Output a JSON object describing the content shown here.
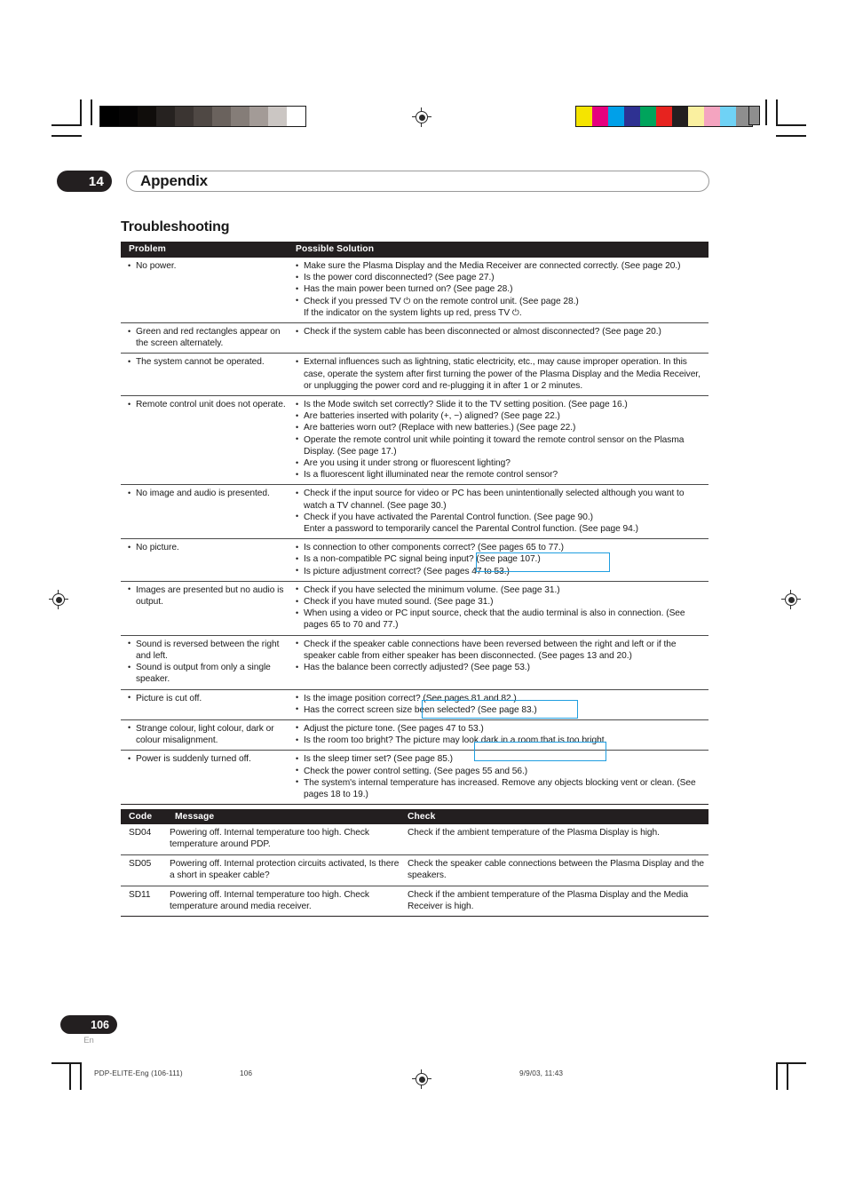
{
  "chapter": {
    "number": "14",
    "title": "Appendix"
  },
  "section": {
    "title": "Troubleshooting"
  },
  "tables": {
    "troubleshooting": {
      "headers": {
        "problem": "Problem",
        "solution": "Possible Solution"
      },
      "rows": [
        {
          "problem": [
            "No power."
          ],
          "solution": [
            "Make sure the Plasma Display and the Media Receiver are connected correctly. (See page 20.)",
            "Is the power cord disconnected? (See page 27.)",
            "Has the main power been turned on? (See page 28.)",
            "Check if you pressed TV ⏻ on the remote control unit. (See page 28.)|If the indicator on the system lights up red, press TV ⏻."
          ]
        },
        {
          "problem": [
            "Green and red rectangles appear on the screen alternately."
          ],
          "solution": [
            "Check if the system cable has been disconnected or almost disconnected? (See page 20.)"
          ]
        },
        {
          "problem": [
            "The system cannot be operated."
          ],
          "solution": [
            "External influences such as lightning, static electricity, etc., may cause improper operation. In this case, operate the system after first turning the power of the Plasma Display and the Media Receiver, or unplugging the power cord and re-plugging it in after 1 or 2 minutes."
          ]
        },
        {
          "problem": [
            "Remote control unit does not operate."
          ],
          "solution": [
            "Is the Mode switch set correctly? Slide it to the TV setting position. (See page 16.)",
            "Are batteries inserted with polarity (+, −) aligned? (See page 22.)",
            "Are batteries worn out? (Replace with new batteries.) (See page 22.)",
            "Operate the remote control unit while pointing it toward the remote control sensor on the Plasma Display. (See page 17.)",
            "Are you using it under strong or fluorescent lighting?",
            "Is a fluorescent light illuminated near the remote control sensor?"
          ]
        },
        {
          "problem": [
            "No image and audio is presented."
          ],
          "solution": [
            "Check if the input source for video or PC has been unintentionally selected although you want to watch a TV channel. (See page 30.)",
            "Check if you have activated the Parental Control function. (See page 90.)|Enter a password to temporarily cancel the Parental Control function. (See page 94.)"
          ]
        },
        {
          "problem": [
            "No picture."
          ],
          "solution": [
            "Is connection to other components correct? (See pages 65 to 77.)",
            "Is a non-compatible PC signal being input? (See page 107.)",
            "Is picture adjustment correct? (See pages 47 to 53.)"
          ]
        },
        {
          "problem": [
            "Images are presented but no audio is output."
          ],
          "solution": [
            "Check if you have selected the minimum volume. (See page 31.)",
            "Check if you have muted sound. (See page 31.)",
            "When using a video or PC input source, check that the audio terminal is also in connection. (See pages 65 to 70 and 77.)"
          ]
        },
        {
          "problem": [
            "Sound is reversed between the right and left.",
            "Sound is output from only a single speaker."
          ],
          "solution": [
            "Check if the speaker cable connections have been reversed between the right and left or if the speaker cable from either speaker has been disconnected. (See pages 13 and 20.)",
            "Has the balance been correctly adjusted? (See page 53.)"
          ]
        },
        {
          "problem": [
            "Picture is cut off."
          ],
          "solution": [
            "Is the image position correct? (See pages 81 and 82.)",
            "Has the correct screen size been selected? (See page 83.)"
          ]
        },
        {
          "problem": [
            "Strange colour, light colour, dark or colour misalignment."
          ],
          "solution": [
            "Adjust the picture tone. (See pages 47 to 53.)",
            "Is the room too bright? The picture may look dark in a room that is too bright."
          ]
        },
        {
          "problem": [
            "Power is suddenly turned off."
          ],
          "solution": [
            "Is the sleep timer set? (See page 85.)",
            "Check the power control setting. (See pages 55 and 56.)",
            "The system's internal temperature has increased. Remove any objects blocking vent or clean. (See pages 18 to 19.)"
          ]
        }
      ]
    },
    "codes": {
      "headers": {
        "code": "Code",
        "message": "Message",
        "check": "Check"
      },
      "rows": [
        {
          "code": "SD04",
          "message": "Powering off. Internal temperature too high. Check temperature around PDP.",
          "check": "Check if the ambient temperature of the Plasma Display is high."
        },
        {
          "code": "SD05",
          "message": "Powering off. Internal protection circuits activated, Is there a short in speaker cable?",
          "check": "Check the speaker cable connections between the Plasma Display and the speakers."
        },
        {
          "code": "SD11",
          "message": "Powering off. Internal temperature too high. Check temperature around media receiver.",
          "check": "Check if the ambient temperature of the Plasma Display and the Media Receiver is high."
        }
      ]
    }
  },
  "page": {
    "number": "106",
    "language": "En"
  },
  "print_footer": {
    "job": "PDP-ELITE-Eng (106-111)",
    "folio": "106",
    "timestamp": "9/9/03, 11:43"
  },
  "print_marks": {
    "grayscale_swatches": [
      "#000000",
      "#050404",
      "#100d0b",
      "#262220",
      "#3b3532",
      "#4f4844",
      "#6a625d",
      "#857d78",
      "#a39b97",
      "#cbc6c3",
      "#ffffff"
    ],
    "color_swatches": [
      "#f5e400",
      "#e6007e",
      "#00a0e9",
      "#2e3192",
      "#00a45c",
      "#e7231f",
      "#231f20",
      "#faf0a0",
      "#f4a4c0",
      "#6fd2f5",
      "#8e8e8e"
    ],
    "right_lone_swatch": "#8e8e8e"
  },
  "annotations": {
    "highlight_color": "#1f9ee0",
    "boxes": [
      {
        "label": "pages-47-to-53-no-picture"
      },
      {
        "label": "pages-47-to-53-picture-tone"
      },
      {
        "label": "pages-55-and-56-power-control"
      }
    ]
  }
}
